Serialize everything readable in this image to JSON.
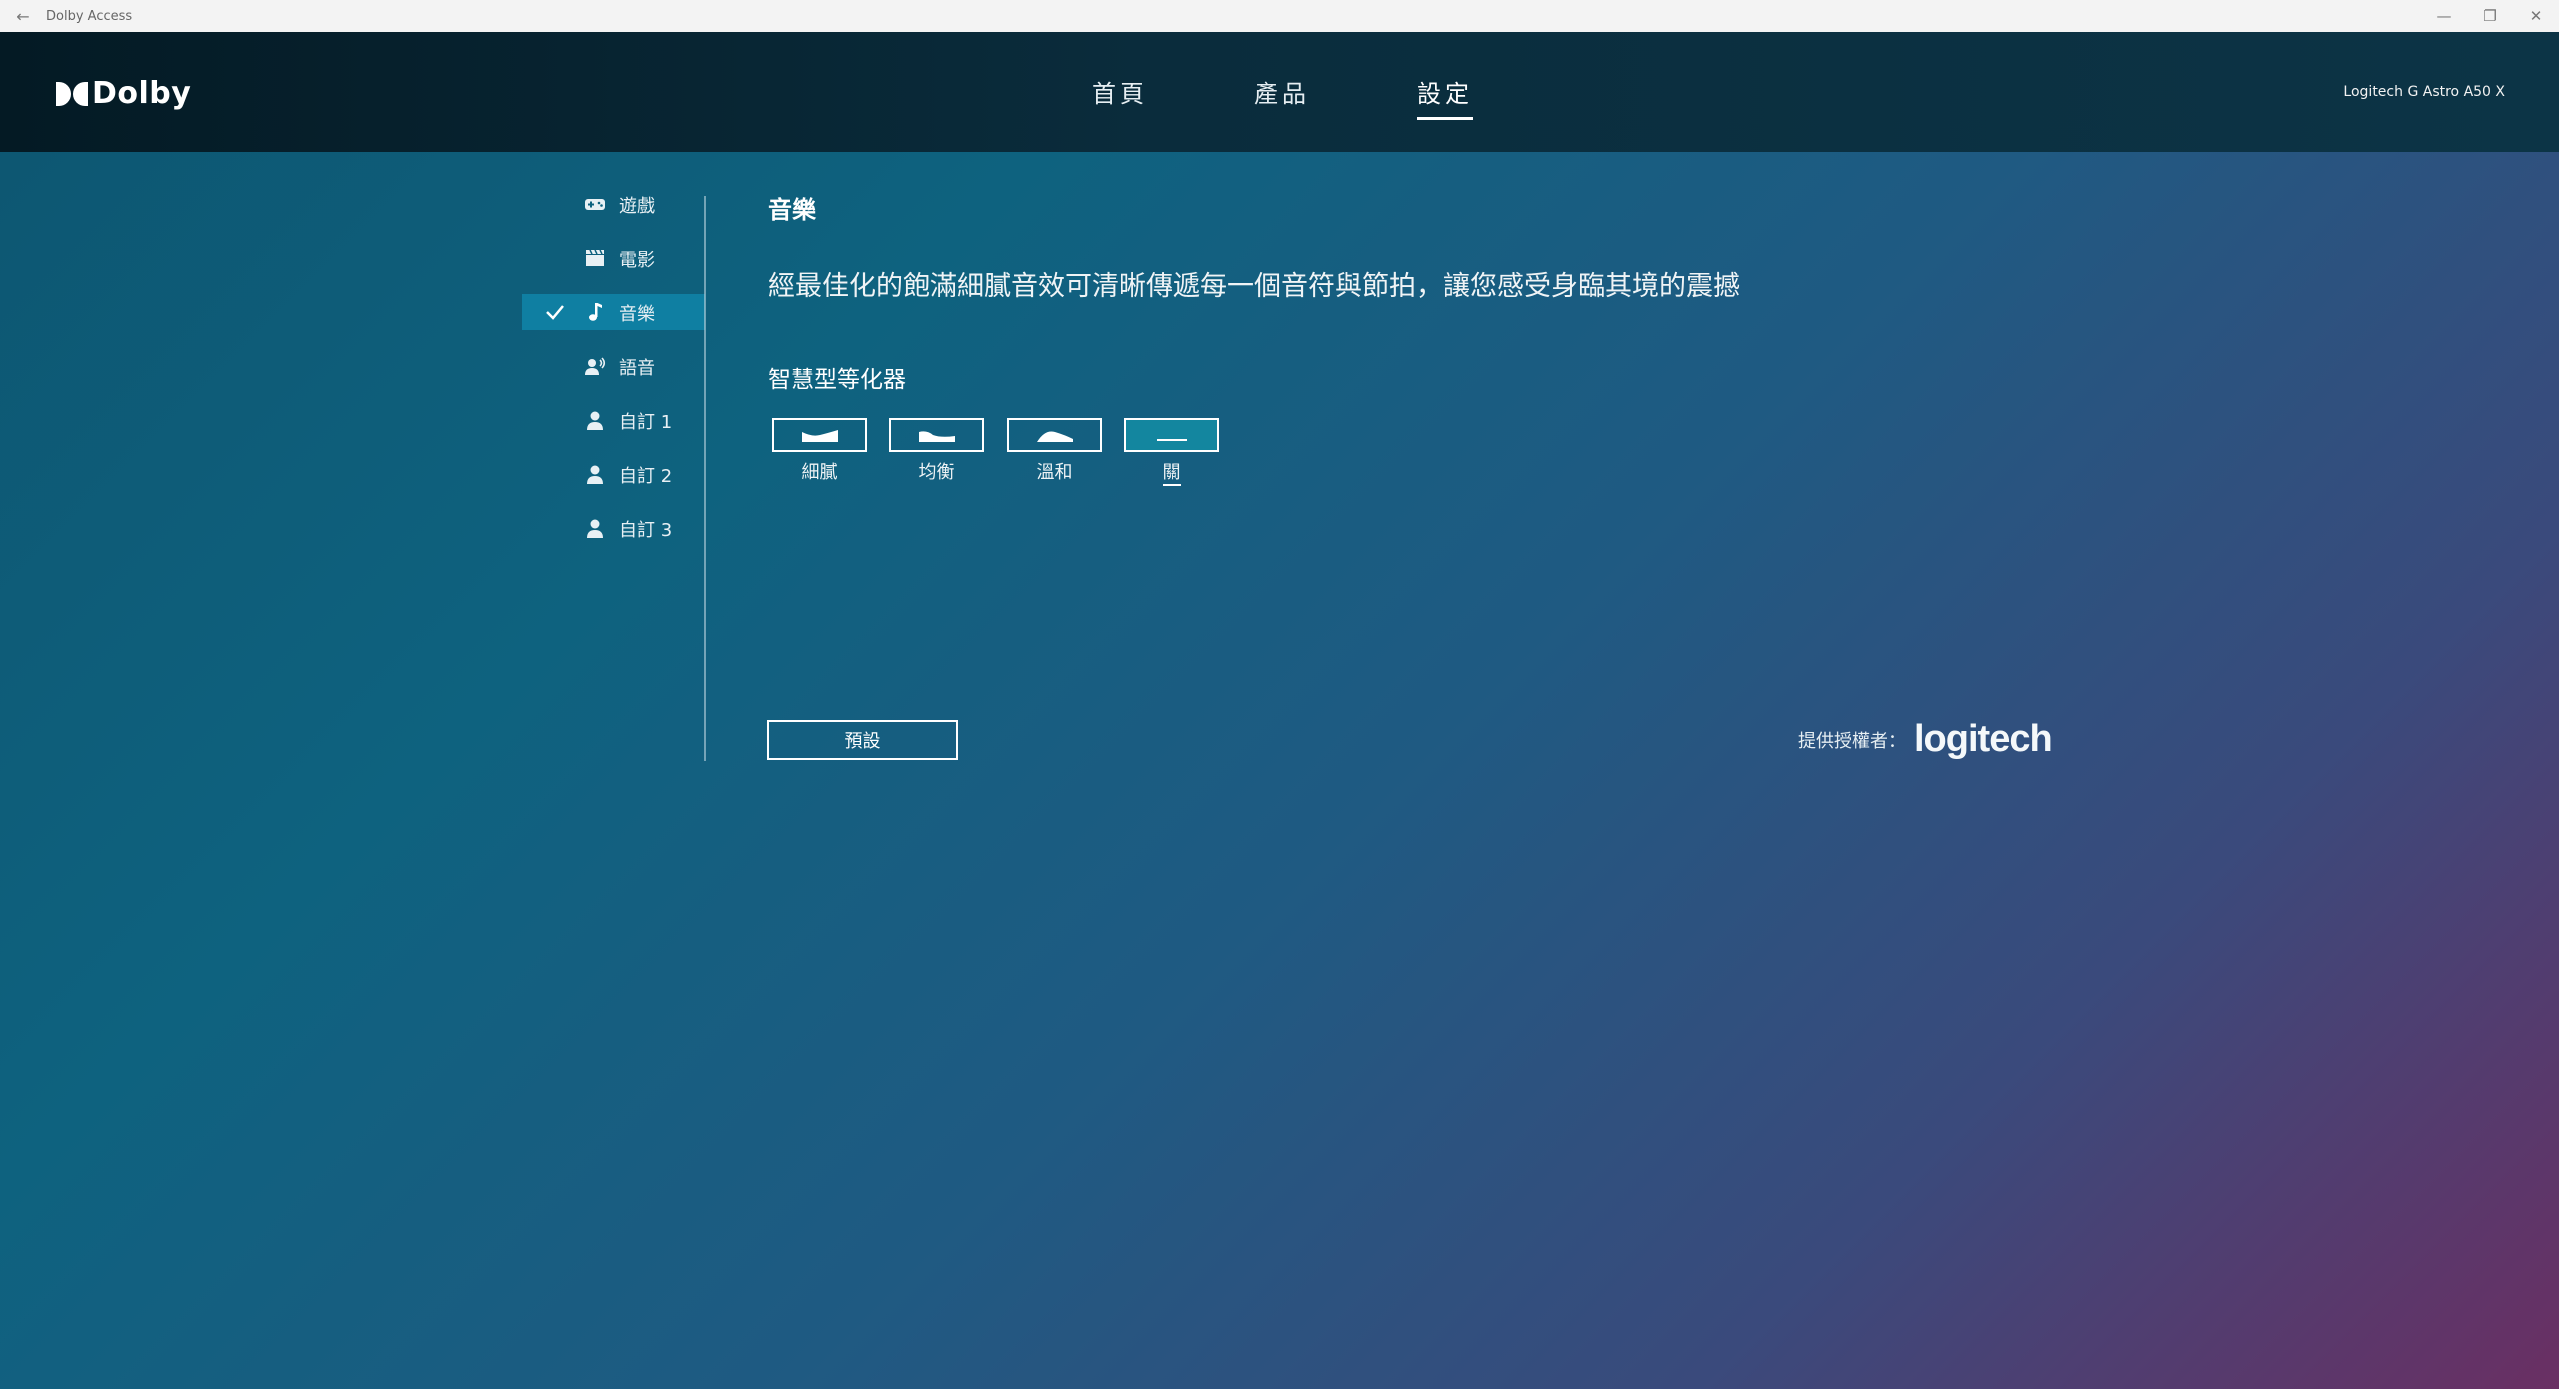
{
  "titlebar": {
    "title": "Dolby Access",
    "back_icon": "←",
    "min_icon": "—",
    "max_icon": "❐",
    "close_icon": "✕"
  },
  "header": {
    "logo_text": "Dolby",
    "nav": [
      {
        "label": "首頁",
        "active": false
      },
      {
        "label": "產品",
        "active": false
      },
      {
        "label": "設定",
        "active": true
      }
    ],
    "device": "Logitech G Astro A50 X"
  },
  "sidebar": {
    "items": [
      {
        "label": "遊戲",
        "icon": "gamepad-icon",
        "active": false
      },
      {
        "label": "電影",
        "icon": "film-icon",
        "active": false
      },
      {
        "label": "音樂",
        "icon": "music-note-icon",
        "active": true
      },
      {
        "label": "語音",
        "icon": "voice-icon",
        "active": false
      },
      {
        "label": "自訂 1",
        "icon": "person-icon",
        "active": false
      },
      {
        "label": "自訂 2",
        "icon": "person-icon",
        "active": false
      },
      {
        "label": "自訂 3",
        "icon": "person-icon",
        "active": false
      }
    ]
  },
  "main": {
    "title": "音樂",
    "description": "經最佳化的飽滿細膩音效可清晰傳遞每一個音符與節拍，讓您感受身臨其境的震撼",
    "equalizer": {
      "title": "智慧型等化器",
      "options": [
        {
          "label": "細膩",
          "active": false
        },
        {
          "label": "均衡",
          "active": false
        },
        {
          "label": "溫和",
          "active": false
        },
        {
          "label": "關",
          "active": true
        }
      ]
    },
    "default_button": "預設",
    "powered_by_label": "提供授權者：",
    "powered_by_brand": "logitech"
  }
}
